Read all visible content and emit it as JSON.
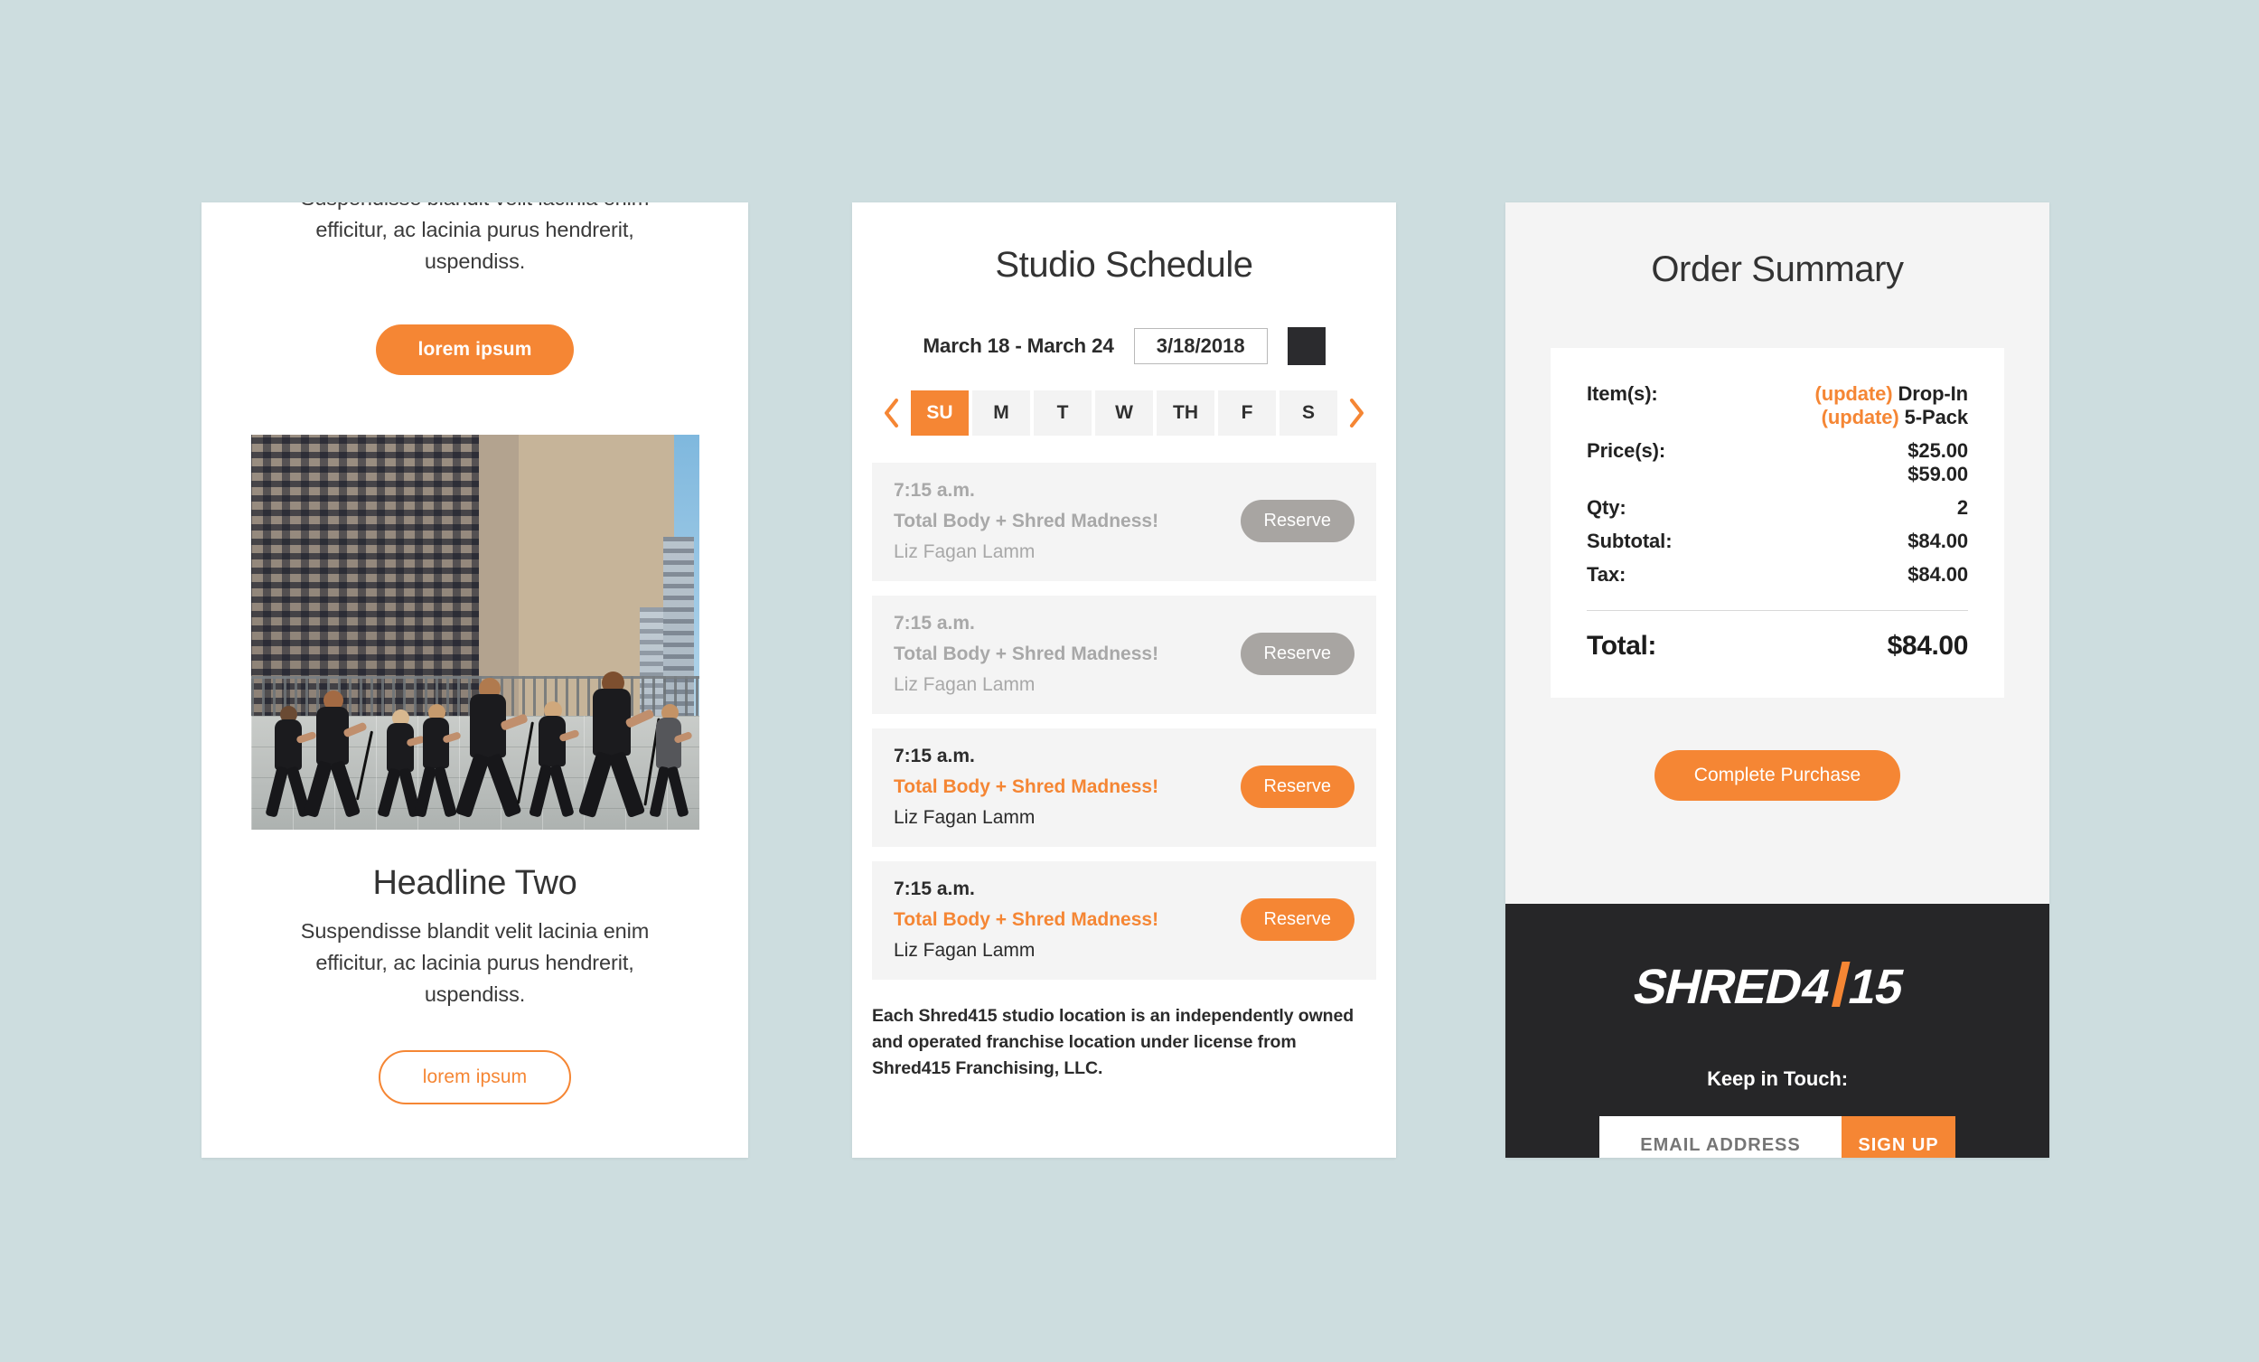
{
  "theme": {
    "page_background": "#cddddf",
    "accent_orange": "#f58634",
    "dark": "#262628",
    "muted_gray": "#a8a5a2"
  },
  "left_panel": {
    "intro_paragraph": "Suspendisse blandit velit lacinia enim efficitur, ac lacinia purus hendrerit, uspendiss.",
    "cta_top_label": "lorem ipsum",
    "photo_alt": "group fitness class exercising with resistance bands on a city rooftop",
    "headline": "Headline Two",
    "body_paragraph": "Suspendisse blandit velit lacinia enim efficitur, ac lacinia purus hendrerit, uspendiss.",
    "cta_bottom_label": "lorem ipsum"
  },
  "schedule_panel": {
    "title": "Studio Schedule",
    "week_range": "March 18 - March 24",
    "date_value": "3/18/2018",
    "calendar_icon": "calendar-icon",
    "prev_icon": "chevron-left-icon",
    "next_icon": "chevron-right-icon",
    "days": [
      {
        "label": "SU",
        "active": true
      },
      {
        "label": "M",
        "active": false
      },
      {
        "label": "T",
        "active": false
      },
      {
        "label": "W",
        "active": false
      },
      {
        "label": "TH",
        "active": false
      },
      {
        "label": "F",
        "active": false
      },
      {
        "label": "S",
        "active": false
      }
    ],
    "classes": [
      {
        "time": "7:15 a.m.",
        "name": "Total Body + Shred Madness!",
        "instructor": "Liz Fagan Lamm",
        "reserve_label": "Reserve",
        "state": "disabled"
      },
      {
        "time": "7:15 a.m.",
        "name": "Total Body + Shred Madness!",
        "instructor": "Liz Fagan Lamm",
        "reserve_label": "Reserve",
        "state": "disabled"
      },
      {
        "time": "7:15 a.m.",
        "name": "Total Body + Shred Madness!",
        "instructor": "Liz Fagan Lamm",
        "reserve_label": "Reserve",
        "state": "available"
      },
      {
        "time": "7:15 a.m.",
        "name": "Total Body + Shred Madness!",
        "instructor": "Liz Fagan Lamm",
        "reserve_label": "Reserve",
        "state": "available"
      }
    ],
    "legal_note": "Each Shred415 studio location is an independently owned and operated franchise location under license from Shred415 Franchising, LLC."
  },
  "order_panel": {
    "title": "Order Summary",
    "items_label": "Item(s):",
    "item_update_label": "(update)",
    "item_1_name": "Drop-In",
    "item_2_name": "5-Pack",
    "prices_label": "Price(s):",
    "price_1": "$25.00",
    "price_2": "$59.00",
    "qty_label": "Qty:",
    "qty_value": "2",
    "subtotal_label": "Subtotal:",
    "subtotal_value": "$84.00",
    "tax_label": "Tax:",
    "tax_value": "$84.00",
    "total_label": "Total:",
    "total_value": "$84.00",
    "purchase_label": "Complete Purchase"
  },
  "footer": {
    "logo_main": "SHRED",
    "logo_four": "4",
    "logo_slash": "/",
    "logo_fifteen": "15",
    "keep_in_touch": "Keep in Touch:",
    "email_placeholder": "EMAIL ADDRESS",
    "signup_label": "SIGN UP"
  }
}
